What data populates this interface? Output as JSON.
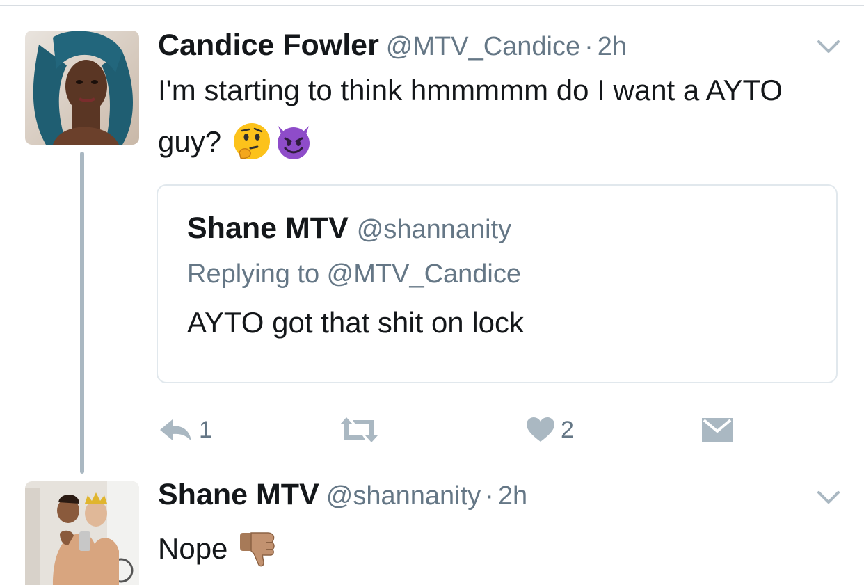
{
  "tweets": [
    {
      "name": "Candice Fowler",
      "handle": "@MTV_Candice",
      "separator": "·",
      "time": "2h",
      "text": "I'm starting to think  hmmmmm do I want a AYTO guy?",
      "emojis": [
        "thinking-face",
        "smiling-imp"
      ],
      "quoted": {
        "name": "Shane MTV",
        "handle": "@shannanity",
        "replying_to": "Replying to @MTV_Candice",
        "text": "AYTO got that shit on lock"
      },
      "actions": {
        "reply_count": "1",
        "retweet_count": "",
        "like_count": "2"
      }
    },
    {
      "name": "Shane MTV",
      "handle": "@shannanity",
      "separator": "·",
      "time": "2h",
      "text": "Nope",
      "emojis": [
        "thumbs-down"
      ]
    }
  ],
  "colors": {
    "text": "#14171a",
    "secondary": "#657786",
    "icon": "#aab8c2",
    "border": "#e1e8ed"
  },
  "icons": {
    "reply": "reply-icon",
    "retweet": "retweet-icon",
    "like": "heart-icon",
    "dm": "envelope-icon",
    "more": "chevron-down-icon"
  }
}
